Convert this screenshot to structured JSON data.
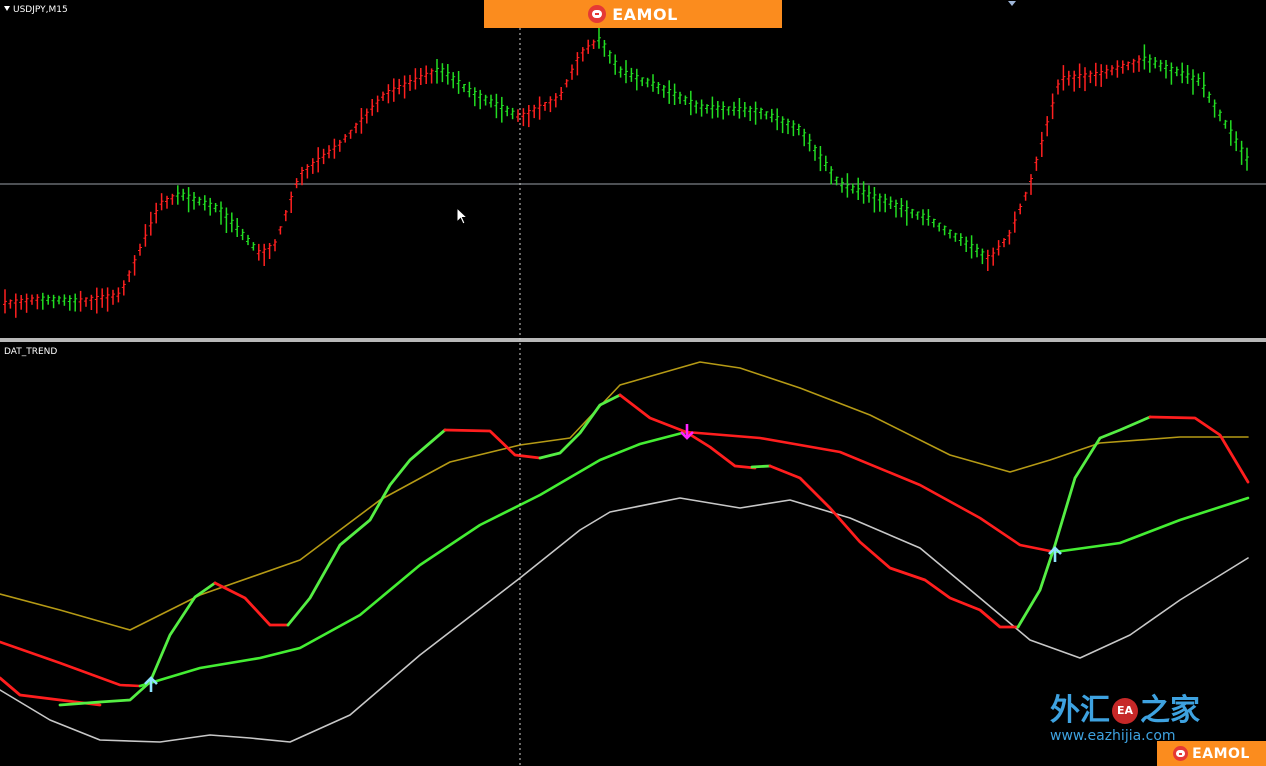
{
  "window": {
    "symbol_label": "USDJPY,M15",
    "indicator_label": "DAT_TREND"
  },
  "branding": {
    "banner_text": "EAMOL",
    "corner_text": "EAMOL",
    "watermark_text": "外汇",
    "watermark_text2": "之家",
    "watermark_seal": "EA",
    "watermark_url": "www.eazhijia.com"
  },
  "colors": {
    "background": "#000000",
    "bull": "#ff2020",
    "bear": "#22dd22",
    "trend_up": "#55ee44",
    "trend_down": "#ff1e1e",
    "upper_band": "#b59a15",
    "lower_band": "#c8c8c8",
    "middle_line": "#44ee33",
    "buy_arrow": "#8fe3ff",
    "sell_arrow": "#ff22ff",
    "banner": "#fb8c1e",
    "watermark": "#3ea2e0"
  },
  "icons": {
    "buy_signal": "arrow-up-icon",
    "sell_signal": "arrow-down-icon",
    "cursor": "mouse-pointer-icon"
  }
}
